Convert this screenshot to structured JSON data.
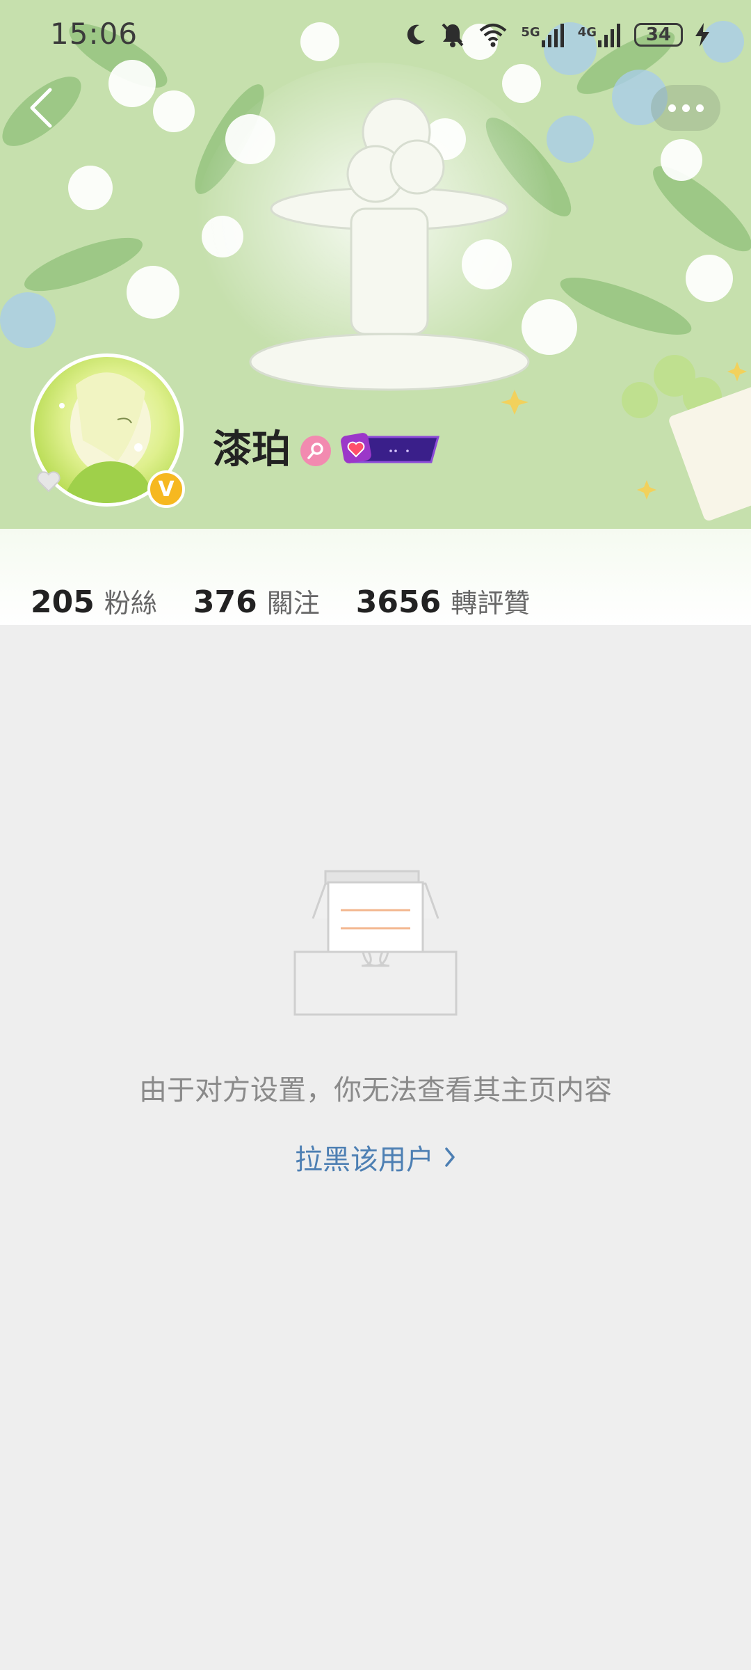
{
  "status_bar": {
    "time": "15:06",
    "signal_1_label": "5G",
    "signal_2_label": "4G",
    "battery": "34",
    "icons": [
      "moon-icon",
      "bell-muted-icon",
      "wifi-icon",
      "signal-5g-icon",
      "signal-4g-icon",
      "battery-icon",
      "charging-icon"
    ]
  },
  "nav": {
    "back_icon": "chevron-left-icon",
    "more_icon": "more-dots-icon"
  },
  "profile": {
    "name": "漆珀",
    "verified_badge": "V",
    "gender_icon": "female-icon",
    "fan_badge_icon": "heart-badge-icon"
  },
  "stats": [
    {
      "value": "205",
      "label": "粉絲"
    },
    {
      "value": "376",
      "label": "關注"
    },
    {
      "value": "3656",
      "label": "轉評贊"
    }
  ],
  "empty_state": {
    "illustration_icon": "empty-inbox-icon",
    "message": "由于对方设置，你无法查看其主页内容",
    "action_label": "拉黑该用户",
    "action_icon": "chevron-right-icon"
  },
  "colors": {
    "link": "#4d7fb3",
    "page_background": "#eeeeee",
    "verified": "#f6b820",
    "gender": "#f28ab0"
  }
}
